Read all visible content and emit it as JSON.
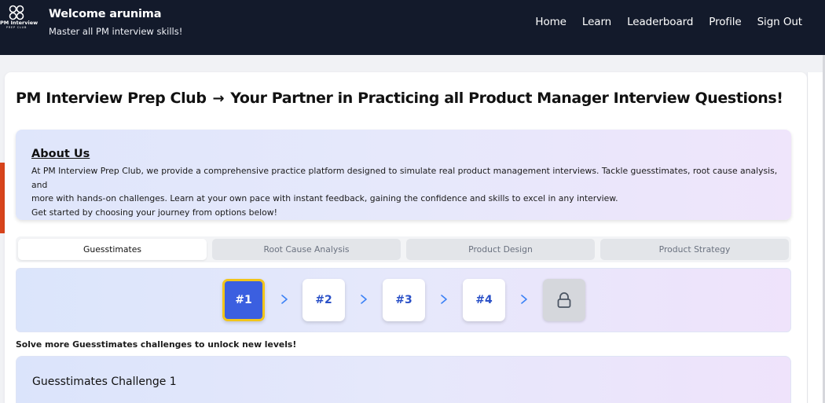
{
  "brand": {
    "logo_name": "PM Interview",
    "logo_sub": "PREP CLUB",
    "welcome": "Welcome arunima",
    "tagline": "Master all PM interview skills!"
  },
  "nav": [
    {
      "label": "Home"
    },
    {
      "label": "Learn"
    },
    {
      "label": "Leaderboard"
    },
    {
      "label": "Profile"
    },
    {
      "label": "Sign Out"
    }
  ],
  "page": {
    "title_left": "PM Interview Prep Club",
    "title_arrow": "→",
    "title_right": "Your Partner in Practicing all Product Manager Interview Questions!"
  },
  "about": {
    "title": "About Us",
    "line1": "At PM Interview Prep Club, we provide a comprehensive practice platform designed to simulate real product management interviews. Tackle guesstimates, root cause analysis, and",
    "line2": "more with hands-on challenges. Learn at your own pace with instant feedback, gaining the confidence and skills to excel in any interview.",
    "line3": "Get started by choosing your journey from options below!"
  },
  "tabs": [
    {
      "label": "Guesstimates",
      "active": true
    },
    {
      "label": "Root Cause Analysis",
      "active": false
    },
    {
      "label": "Product Design",
      "active": false
    },
    {
      "label": "Product Strategy",
      "active": false
    }
  ],
  "levels": [
    {
      "label": "#1",
      "state": "active"
    },
    {
      "label": "#2",
      "state": "available"
    },
    {
      "label": "#3",
      "state": "available"
    },
    {
      "label": "#4",
      "state": "available"
    },
    {
      "label": "",
      "state": "locked",
      "icon": "lock-icon"
    }
  ],
  "colors": {
    "header_bg": "#131a2b",
    "active_level": "#3b5fe0",
    "active_level_border": "#f2c51a",
    "side_tab": "#d8441c"
  },
  "unlock_message": "Solve more Guesstimates challenges to unlock new levels!",
  "challenge": {
    "title": "Guesstimates Challenge 1"
  }
}
